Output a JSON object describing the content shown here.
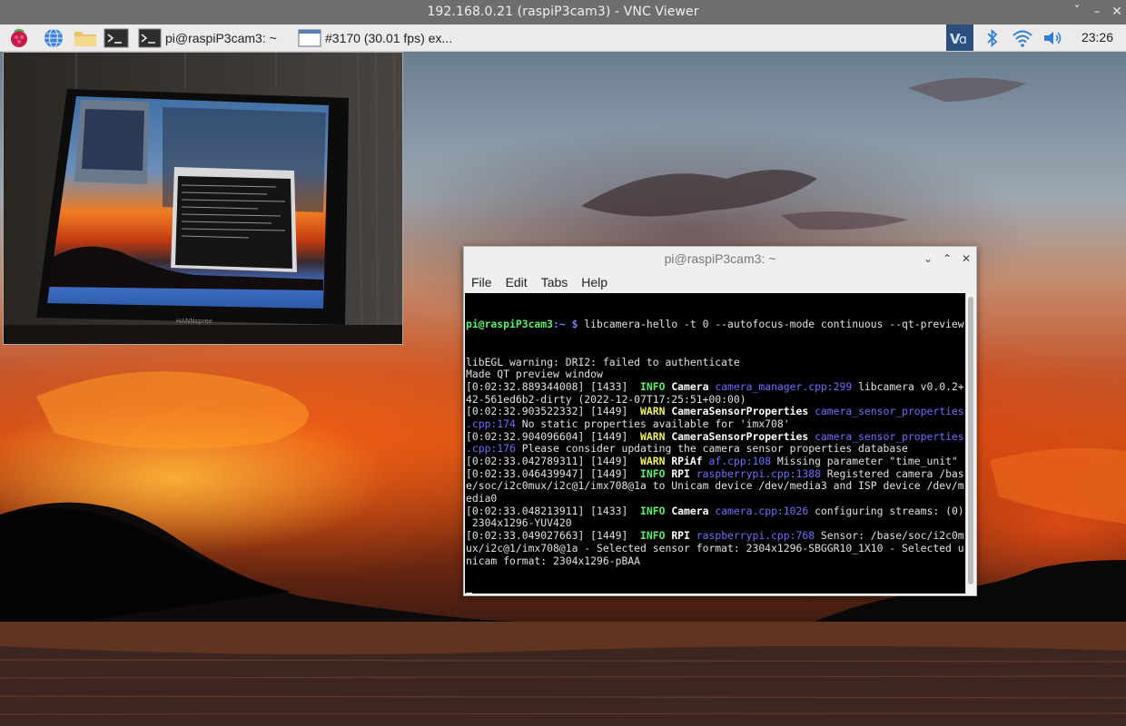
{
  "vnc": {
    "title": "192.168.0.21 (raspiP3cam3) - VNC Viewer",
    "controls": {
      "collapse": "ˇ",
      "minimize": "–",
      "maximize": "□",
      "close": "✕"
    }
  },
  "taskbar": {
    "launchers": [
      "raspberry-menu-icon",
      "browser-globe-icon",
      "file-manager-icon",
      "terminal-icon"
    ],
    "tasks": [
      {
        "label": "pi@raspiP3cam3: ~",
        "icon": "terminal-icon"
      },
      {
        "label": "#3170 (30.01 fps) ex...",
        "icon": "window-icon"
      }
    ],
    "tray": [
      "vnc-icon",
      "bluetooth-icon",
      "wifi-icon",
      "volume-icon"
    ],
    "clock": "23:26"
  },
  "terminal": {
    "title": "pi@raspiP3cam3: ~",
    "menu": [
      "File",
      "Edit",
      "Tabs",
      "Help"
    ],
    "prompt_user": "pi@raspiP3cam3",
    "prompt_path": ":~ $",
    "command": " libcamera-hello -t 0 --autofocus-mode continuous --qt-preview",
    "lines": [
      {
        "t": "libEGL warning: DRI2: failed to authenticate"
      },
      {
        "t": "Made QT preview window"
      },
      {
        "ts": "[0:02:32.889344008] [1433]  ",
        "level": "INFO",
        "cat": " Camera ",
        "src": "camera_manager.cpp:299",
        "msg": " libcamera v0.0.2+"
      },
      {
        "t": "42-561ed6b2-dirty (2022-12-07T17:25:51+00:00)"
      },
      {
        "ts": "[0:02:32.903522332] [1449]  ",
        "level": "WARN",
        "cat": " CameraSensorProperties ",
        "src": "camera_sensor_properties",
        "msg": ""
      },
      {
        "src2": ".cpp:174",
        "msg": " No static properties available for 'imx708'"
      },
      {
        "ts": "[0:02:32.904096604] [1449]  ",
        "level": "WARN",
        "cat": " CameraSensorProperties ",
        "src": "camera_sensor_properties",
        "msg": ""
      },
      {
        "src2": ".cpp:176",
        "msg": " Please consider updating the camera sensor properties database"
      },
      {
        "ts": "[0:02:33.042789311] [1449]  ",
        "level": "WARN",
        "cat": " RPiAf ",
        "src": "af.cpp:108",
        "msg": " Missing parameter \"time_unit\""
      },
      {
        "ts": "[0:02:33.046439947] [1449]  ",
        "level": "INFO",
        "cat": " RPI ",
        "src": "raspberrypi.cpp:1388",
        "msg": " Registered camera /bas"
      },
      {
        "t": "e/soc/i2c0mux/i2c@1/imx708@1a to Unicam device /dev/media3 and ISP device /dev/m"
      },
      {
        "t": "edia0"
      },
      {
        "ts": "[0:02:33.048213911] [1433]  ",
        "level": "INFO",
        "cat": " Camera ",
        "src": "camera.cpp:1026",
        "msg": " configuring streams: (0)"
      },
      {
        "t": " 2304x1296-YUV420"
      },
      {
        "ts": "[0:02:33.049027663] [1449]  ",
        "level": "INFO",
        "cat": " RPI ",
        "src": "raspberrypi.cpp:768",
        "msg": " Sensor: /base/soc/i2c0m"
      },
      {
        "t": "ux/i2c@1/imx708@1a - Selected sensor format: 2304x1296-SBGGR10_1X10 - Selected u"
      },
      {
        "t": "nicam format: 2304x1296-pBAA"
      }
    ]
  },
  "preview": {
    "monitor_brand": "HANNspree"
  }
}
